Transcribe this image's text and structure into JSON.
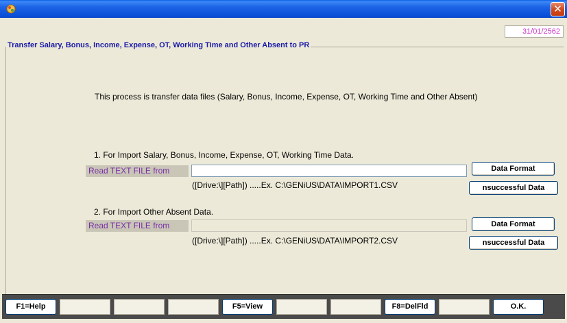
{
  "window": {
    "title": "",
    "app_icon": "app-icon",
    "close_glyph": "✕"
  },
  "header": {
    "date": "31/01/2562"
  },
  "group": {
    "title": "Transfer Salary, Bonus, Income, Expense, OT, Working Time and Other Absent to PR"
  },
  "description": "This process is transfer data files (Salary, Bonus, Income, Expense, OT, Working Time and Other Absent)",
  "sections": [
    {
      "title": "1. For Import Salary, Bonus, Income, Expense, OT, Working Time Data.",
      "read_label": "Read TEXT FILE from",
      "path_value": "",
      "hint": "([Drive:\\][Path]) .....Ex. C:\\GENiUS\\DATA\\IMPORT1.CSV",
      "data_format_label": "Data Format",
      "unsuccessful_label": "nsuccessful Data"
    },
    {
      "title": "2. For Import Other Absent Data.",
      "read_label": "Read TEXT FILE from",
      "path_value": "",
      "hint": "([Drive:\\][Path]) .....Ex. C:\\GENiUS\\DATA\\IMPORT2.CSV",
      "data_format_label": "Data Format",
      "unsuccessful_label": "nsuccessful Data"
    }
  ],
  "function_keys": [
    {
      "label": "F1=Help"
    },
    {
      "label": ""
    },
    {
      "label": ""
    },
    {
      "label": ""
    },
    {
      "label": "F5=View"
    },
    {
      "label": ""
    },
    {
      "label": ""
    },
    {
      "label": "F8=DelFld"
    },
    {
      "label": ""
    },
    {
      "label": "O.K."
    }
  ],
  "colors": {
    "accent_title": "#1a1aa8",
    "label_purple": "#7b2fa8",
    "date_magenta": "#cc33cc",
    "titlebar_blue": "#0a5ee8",
    "close_red": "#d24a1e"
  }
}
